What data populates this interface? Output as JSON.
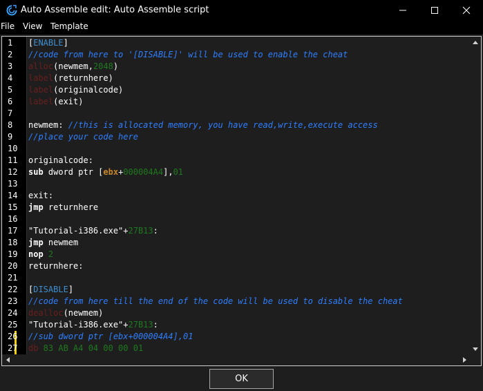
{
  "window": {
    "title": "Auto Assemble edit: Auto Assemble script"
  },
  "menu": {
    "items": [
      "File",
      "View",
      "Template"
    ]
  },
  "editor": {
    "lines": [
      {
        "n": "1",
        "tokens": [
          {
            "t": "[",
            "c": "txt"
          },
          {
            "t": "ENABLE",
            "c": "sect"
          },
          {
            "t": "]",
            "c": "txt"
          }
        ]
      },
      {
        "n": "2",
        "tokens": [
          {
            "t": "//code from here to '[DISABLE]' will be used to enable the cheat",
            "c": "com"
          }
        ]
      },
      {
        "n": "3",
        "tokens": [
          {
            "t": "alloc",
            "c": "dir"
          },
          {
            "t": "(newmem,",
            "c": "txt"
          },
          {
            "t": "2048",
            "c": "num"
          },
          {
            "t": ")",
            "c": "txt"
          }
        ]
      },
      {
        "n": "4",
        "tokens": [
          {
            "t": "label",
            "c": "dir"
          },
          {
            "t": "(returnhere)",
            "c": "txt"
          }
        ]
      },
      {
        "n": "5",
        "tokens": [
          {
            "t": "label",
            "c": "dir"
          },
          {
            "t": "(originalcode)",
            "c": "txt"
          }
        ]
      },
      {
        "n": "6",
        "tokens": [
          {
            "t": "label",
            "c": "dir"
          },
          {
            "t": "(exit)",
            "c": "txt"
          }
        ]
      },
      {
        "n": "7",
        "tokens": []
      },
      {
        "n": "8",
        "tokens": [
          {
            "t": "newmem: ",
            "c": "txt"
          },
          {
            "t": "//this is allocated memory, you have read,write,execute access",
            "c": "com"
          }
        ]
      },
      {
        "n": "9",
        "tokens": [
          {
            "t": "//place your code here",
            "c": "com"
          }
        ]
      },
      {
        "n": "10",
        "tokens": []
      },
      {
        "n": "11",
        "tokens": [
          {
            "t": "originalcode:",
            "c": "txt"
          }
        ]
      },
      {
        "n": "12",
        "tokens": [
          {
            "t": "sub",
            "c": "kw"
          },
          {
            "t": " dword ptr [",
            "c": "txt"
          },
          {
            "t": "ebx",
            "c": "reg"
          },
          {
            "t": "+",
            "c": "txt"
          },
          {
            "t": "000004A4",
            "c": "num"
          },
          {
            "t": "],",
            "c": "txt"
          },
          {
            "t": "01",
            "c": "num"
          }
        ]
      },
      {
        "n": "13",
        "tokens": []
      },
      {
        "n": "14",
        "tokens": [
          {
            "t": "exit:",
            "c": "txt"
          }
        ]
      },
      {
        "n": "15",
        "tokens": [
          {
            "t": "jmp",
            "c": "kw"
          },
          {
            "t": " returnhere",
            "c": "txt"
          }
        ]
      },
      {
        "n": "16",
        "tokens": []
      },
      {
        "n": "17",
        "tokens": [
          {
            "t": "\"Tutorial-i386.exe\"+",
            "c": "txt"
          },
          {
            "t": "27B13",
            "c": "num"
          },
          {
            "t": ":",
            "c": "txt"
          }
        ]
      },
      {
        "n": "18",
        "tokens": [
          {
            "t": "jmp",
            "c": "kw"
          },
          {
            "t": " newmem",
            "c": "txt"
          }
        ]
      },
      {
        "n": "19",
        "tokens": [
          {
            "t": "nop",
            "c": "kw"
          },
          {
            "t": " ",
            "c": "txt"
          },
          {
            "t": "2",
            "c": "num"
          }
        ]
      },
      {
        "n": "20",
        "tokens": [
          {
            "t": "returnhere:",
            "c": "txt"
          }
        ]
      },
      {
        "n": "21",
        "tokens": []
      },
      {
        "n": "22",
        "tokens": [
          {
            "t": "[",
            "c": "txt"
          },
          {
            "t": "DISABLE",
            "c": "sect"
          },
          {
            "t": "]",
            "c": "txt"
          }
        ]
      },
      {
        "n": "23",
        "tokens": [
          {
            "t": "//code from here till the end of the code will be used to disable the cheat",
            "c": "com"
          }
        ]
      },
      {
        "n": "24",
        "tokens": [
          {
            "t": "dealloc",
            "c": "dir"
          },
          {
            "t": "(newmem)",
            "c": "txt"
          }
        ]
      },
      {
        "n": "25",
        "tokens": [
          {
            "t": "\"Tutorial-i386.exe\"+",
            "c": "txt"
          },
          {
            "t": "27B13",
            "c": "num"
          },
          {
            "t": ":",
            "c": "txt"
          }
        ]
      },
      {
        "n": "26",
        "tokens": [
          {
            "t": "//sub dword ptr [ebx+000004A4],01",
            "c": "com"
          }
        ]
      },
      {
        "n": "27",
        "tokens": [
          {
            "t": "db",
            "c": "dir"
          },
          {
            "t": " 83 AB A4 04 00 00 01",
            "c": "num"
          }
        ]
      }
    ],
    "modified_lines": [
      "26",
      "27"
    ]
  },
  "footer": {
    "ok_label": "OK"
  },
  "colors": {
    "background": "#1e1e1e",
    "gutter": "#000000",
    "comment": "#2f7fff",
    "number": "#1e7a1e",
    "directive": "#6a1f1f",
    "section": "#3f8fd0",
    "register": "#c8872a",
    "change_marker": "#f0d000"
  },
  "icons": {
    "app": "cheat-engine-icon",
    "minimize": "minimize-icon",
    "maximize": "maximize-icon",
    "close": "close-icon"
  }
}
